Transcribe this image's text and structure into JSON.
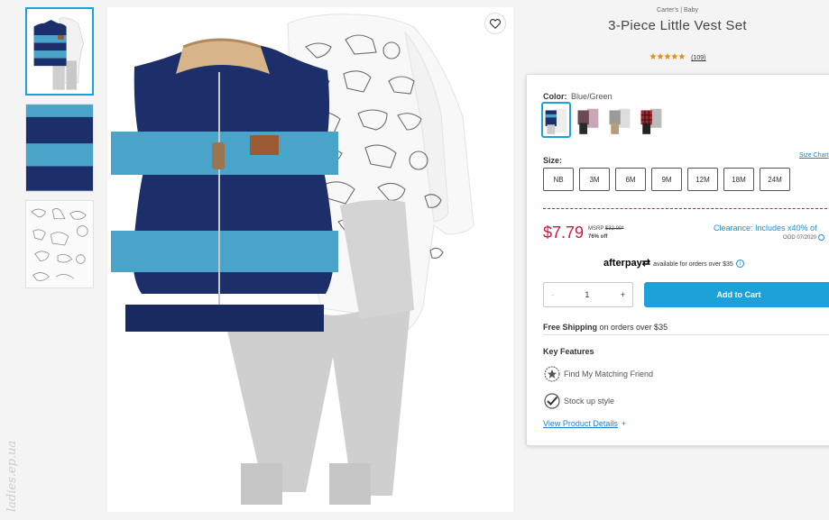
{
  "product": {
    "brand": "Carter's | Baby",
    "title": "3-Piece Little Vest Set",
    "stars": "★★★★★",
    "rating": 5,
    "review_count": "(109)"
  },
  "images": {
    "thumbnails": [
      "vest-set-front",
      "vest-stripe-closeup",
      "bodysuit-print-closeup"
    ],
    "active_index": 0
  },
  "color": {
    "label": "Color:",
    "value": "Blue/Green",
    "swatches": [
      "blue-green",
      "floral",
      "gray-tan",
      "red-plaid"
    ]
  },
  "size": {
    "label": "Size:",
    "chart_link": "Size Chart",
    "options": [
      "NB",
      "3M",
      "6M",
      "9M",
      "12M",
      "18M",
      "24M"
    ]
  },
  "pricing": {
    "price": "$7.79",
    "msrp_label": "MSRP",
    "msrp_value": "$32.00*",
    "discount": "76% off",
    "clearance": "Clearance: Includes x40% of",
    "ood": "OOD 07/2020"
  },
  "afterpay": {
    "brand": "afterpay",
    "text": "available for orders over $35",
    "info": "i"
  },
  "cart": {
    "minus": "-",
    "quantity": "1",
    "plus": "+",
    "add_label": "Add to Cart"
  },
  "shipping": {
    "bold": "Free Shipping",
    "text": "on orders over $35"
  },
  "features": {
    "title": "Key Features",
    "items": [
      "Find My Matching Friend",
      "Stock up style"
    ],
    "view_details": "View Product Details",
    "view_plus": "+"
  },
  "watermark": "ladies.ep.ua",
  "colors": {
    "accent": "#1ca2d9",
    "price_red": "#d4163e",
    "link_blue": "#1c7fd1",
    "vest_navy": "#1d2f6b",
    "vest_light": "#4aa3c9"
  }
}
